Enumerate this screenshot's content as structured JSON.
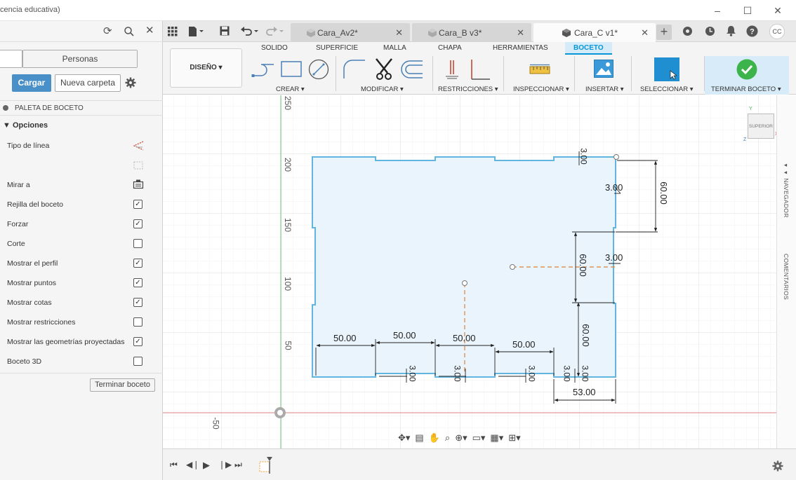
{
  "window": {
    "title": "cencia educativa)",
    "controls": [
      "–",
      "☐",
      "✕"
    ]
  },
  "left_panel": {
    "tabs": [
      "",
      "Personas"
    ],
    "load_button": "Cargar",
    "new_folder_button": "Nueva carpeta",
    "palette_title": "PALETA DE BOCETO",
    "options_header": "▼ Opciones",
    "options": [
      {
        "label": "Tipo de línea",
        "control": "icon"
      },
      {
        "label": "",
        "control": "icon"
      },
      {
        "label": "Mirar a",
        "control": "icon"
      },
      {
        "label": "Rejilla del boceto",
        "checked": true
      },
      {
        "label": "Forzar",
        "checked": true
      },
      {
        "label": "Corte",
        "checked": false
      },
      {
        "label": "Mostrar el perfil",
        "checked": true
      },
      {
        "label": "Mostrar puntos",
        "checked": true
      },
      {
        "label": "Mostrar cotas",
        "checked": true
      },
      {
        "label": "Mostrar restricciones",
        "checked": false
      },
      {
        "label": "Mostrar las geometrías proyectadas",
        "checked": true
      },
      {
        "label": "Boceto 3D",
        "checked": false
      }
    ],
    "finish_button": "Terminar boceto"
  },
  "doc_tabs": [
    {
      "label": "Cara_Av2*",
      "active": false
    },
    {
      "label": "Cara_B v3*",
      "active": false
    },
    {
      "label": "Cara_C v1*",
      "active": true
    }
  ],
  "ribbon": {
    "tabs": [
      "SOLIDO",
      "SUPERFICIE",
      "MALLA",
      "CHAPA",
      "HERRAMIENTAS",
      "BOCETO"
    ],
    "active_tab": "BOCETO",
    "workspace": "DISEÑO ▾",
    "groups": [
      "CREAR ▾",
      "MODIFICAR ▾",
      "RESTRICCIONES ▾",
      "INSPECCIONAR ▾",
      "INSERTAR ▾",
      "SELECCIONAR ▾",
      "TERMINAR BOCETO ▾"
    ]
  },
  "canvas": {
    "axis_labels": [
      "250",
      "200",
      "150",
      "100",
      "50",
      "-50"
    ],
    "dimensions": [
      "3.00",
      "3.00",
      "60.00",
      "3.00",
      "60.00",
      "60.00",
      "50.00",
      "50.00",
      "50.00",
      "50.00",
      "3.00",
      "3.00",
      "3.00",
      "3.00",
      "3.00",
      "53.00"
    ],
    "viewcube": "SUPERIOR",
    "side_panels": [
      "NAVEGADOR",
      "COMENTARIOS"
    ]
  },
  "colors": {
    "accent": "#0696d7",
    "sketch_fill": "#eaf4fd",
    "sketch_line": "#62b5de",
    "grid": "#e6e6e6",
    "finish_green": "#3cb44b"
  }
}
